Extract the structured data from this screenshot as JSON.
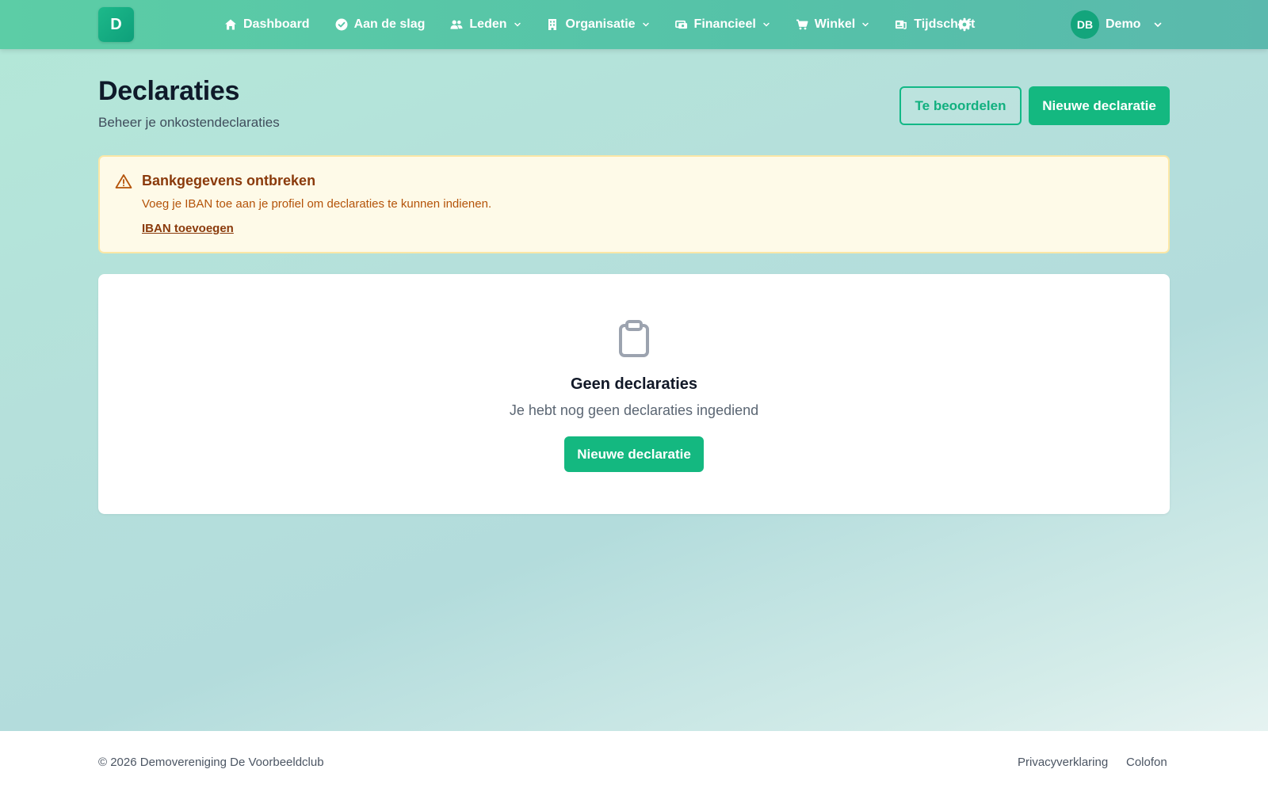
{
  "nav": {
    "logo_letter": "D",
    "items": [
      {
        "label": "Dashboard",
        "icon": "home-icon",
        "has_dropdown": false
      },
      {
        "label": "Aan de slag",
        "icon": "check-circle-icon",
        "has_dropdown": false
      },
      {
        "label": "Leden",
        "icon": "users-icon",
        "has_dropdown": true
      },
      {
        "label": "Organisatie",
        "icon": "building-icon",
        "has_dropdown": true
      },
      {
        "label": "Financieel",
        "icon": "money-icon",
        "has_dropdown": true
      },
      {
        "label": "Winkel",
        "icon": "cart-icon",
        "has_dropdown": true
      },
      {
        "label": "Tijdschrift",
        "icon": "newspaper-icon",
        "has_dropdown": false
      }
    ],
    "settings_icon": "gear-icon",
    "user": {
      "initials": "DB",
      "name": "Demo"
    }
  },
  "header": {
    "title": "Declaraties",
    "subtitle": "Beheer je onkostendeclaraties",
    "review_label": "Te beoordelen",
    "new_label": "Nieuwe declaratie"
  },
  "alert": {
    "icon": "warning-icon",
    "title": "Bankgegevens ontbreken",
    "text": "Voeg je IBAN toe aan je profiel om declaraties te kunnen indienen.",
    "link_label": "IBAN toevoegen"
  },
  "empty": {
    "icon": "clipboard-icon",
    "title": "Geen declaraties",
    "text": "Je hebt nog geen declaraties ingediend",
    "button_label": "Nieuwe declaratie"
  },
  "footer": {
    "copyright": "© 2026 Demovereniging De Voorbeeldclub",
    "links": [
      "Privacyverklaring",
      "Colofon"
    ]
  },
  "colors": {
    "accent": "#14b880",
    "nav_bg": "#57c6a8",
    "alert_bg": "#fefae8",
    "alert_text": "#b45309"
  }
}
